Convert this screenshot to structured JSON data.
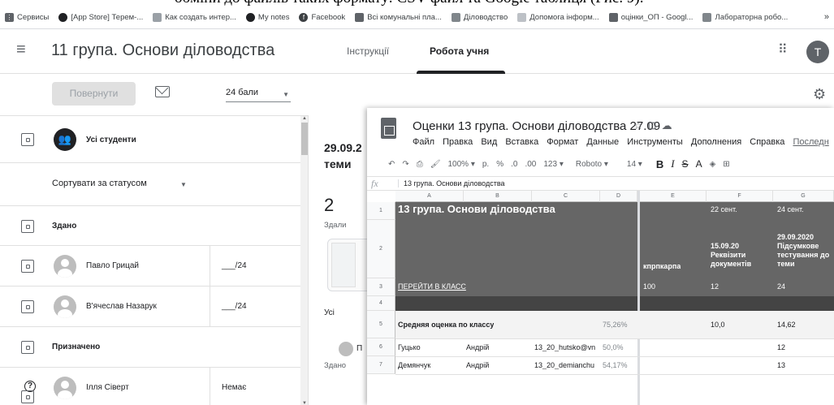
{
  "doc_strip_text": "обміни до файлів таких формату: CSV файл та Google таблиця (Рис. 9).",
  "bookmarks": [
    "Сервисы",
    "[App Store] Терем-...",
    "Как создать интер...",
    "My notes",
    "Facebook",
    "Всі комунальні пла...",
    "Діловодство",
    "Допомога інформ...",
    "оцінки_ОП - Googl...",
    "Лабораторна робо..."
  ],
  "bookmarks_more": "»",
  "header": {
    "course_title": "11 група. Основи діловодства",
    "tabs": [
      "Інструкції",
      "Робота учня"
    ],
    "avatar_letter": "Т"
  },
  "toolbar": {
    "return_label": "Повернути",
    "points": "24 бали"
  },
  "students_panel": {
    "all_students": "Усі студенти",
    "sort_label": "Сортувати за статусом",
    "sections": [
      "Здано",
      "Призначено"
    ],
    "students": [
      {
        "name": "Павло Грицай",
        "grade": "___/24"
      },
      {
        "name": "В'ячеслав Назарук",
        "grade": "___/24"
      },
      {
        "name": "Ілля Сіверт",
        "grade": "Немає"
      }
    ]
  },
  "summary": {
    "title_line1": "29.09.2",
    "title_line2": "теми",
    "handed_in_count": "2",
    "handed_in_label": "Здали",
    "all_label": "Усі",
    "student_initial": "П",
    "status": "Здано"
  },
  "sheet": {
    "title": "Оценки 13 група. Основи діловодства 27.09",
    "menu": [
      "Файл",
      "Правка",
      "Вид",
      "Вставка",
      "Формат",
      "Данные",
      "Инструменты",
      "Дополнения",
      "Справка",
      "Последн"
    ],
    "toolbar": {
      "zoom": "100% ▾",
      "currency": "р.",
      "percent": "%",
      "dec_decimal": ".0",
      "inc_decimal": ".00",
      "more_formats": "123 ▾",
      "font": "Roboto ▾",
      "font_size": "14 ▾",
      "bold": "B",
      "italic": "I",
      "strike": "S",
      "text_color": "A"
    },
    "fx_label": "fx",
    "formula": "13 група. Основи діловодства",
    "columns": [
      "A",
      "B",
      "C",
      "D",
      "E",
      "F",
      "G"
    ],
    "row_numbers": [
      "1",
      "2",
      "3",
      "4",
      "5",
      "6",
      "7"
    ],
    "rows": {
      "heading": "13 група. Основи діловодства",
      "dates": [
        "22 сент.",
        "24 сент."
      ],
      "row2": {
        "e": "кпрпкарпа",
        "f": "15.09.20 Реквізити документів",
        "g": "29.09.2020 Підсумкове тестування до теми"
      },
      "row3": {
        "a": "ПЕРЕЙТИ В КЛАСС",
        "e": "100",
        "f": "12",
        "g": "24"
      },
      "row5": {
        "a": "Средняя оценка по классу",
        "d": "75,26%",
        "f": "10,0",
        "g": "14,62"
      },
      "students": [
        {
          "a": "Гуцько",
          "b": "Андрій",
          "c": "13_20_hutsko@vn",
          "d": "50,0%",
          "g": "12"
        },
        {
          "a": "Демянчук",
          "b": "Андрій",
          "c": "13_20_demianchu",
          "d": "54,17%",
          "g": "13"
        }
      ]
    }
  }
}
